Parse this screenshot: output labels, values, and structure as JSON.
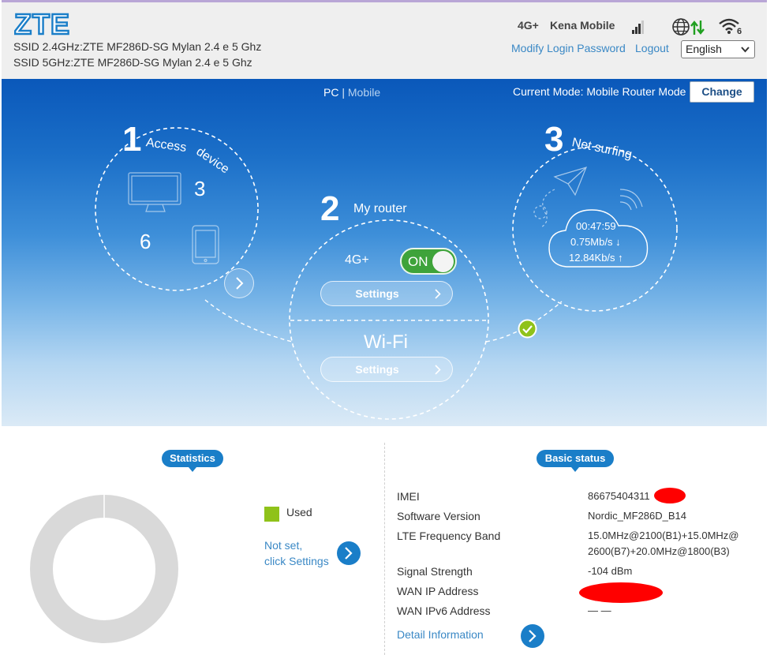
{
  "header": {
    "brand": "ZTE",
    "ssid_24": "SSID 2.4GHz:ZTE MF286D-SG Mylan 2.4 e 5 Ghz",
    "ssid_5": "SSID 5GHz:ZTE MF286D-SG Mylan 2.4 e 5 Ghz",
    "network_type": "4G+",
    "operator": "Kena Mobile",
    "wifi_clients": "6",
    "modify_password": "Modify Login Password",
    "logout": "Logout",
    "language": "English",
    "icons": [
      "signal-icon",
      "globe-icon",
      "updown-arrows-icon",
      "wifi-icon"
    ]
  },
  "hero": {
    "pc_label": "PC",
    "separator": "|",
    "mobile_label": "Mobile",
    "mode_text": "Current Mode: Mobile Router Mode",
    "change_label": "Change",
    "step1": {
      "num": "1",
      "title_a": "Access",
      "title_b": "device",
      "pc_count": "3",
      "mobile_count": "6"
    },
    "step2": {
      "num": "2",
      "title": "My router",
      "lte_label": "4G+",
      "toggle": "ON",
      "settings1": "Settings",
      "wifi_label": "Wi-Fi",
      "settings2": "Settings"
    },
    "step3": {
      "num": "3",
      "title": "Net surfing",
      "time": "00:47:59",
      "down": "0.75Mb/s ↓",
      "up": "12.84Kb/s ↑"
    },
    "colors": {
      "toggle_on": "#3ea33a",
      "check": "#8fc21a"
    }
  },
  "statistics": {
    "tag": "Statistics",
    "legend_used": "Used",
    "notset_line1": "Not set,",
    "notset_line2": "click Settings",
    "used_color": "#8fc21a"
  },
  "basic_status": {
    "tag": "Basic status",
    "rows": [
      {
        "label": "IMEI",
        "value": "86675404311"
      },
      {
        "label": "Software Version",
        "value": "Nordic_MF286D_B14"
      },
      {
        "label": "LTE Frequency Band",
        "value_line1": "15.0MHz@2100(B1)+15.0MHz@",
        "value_line2": "2600(B7)+20.0MHz@1800(B3)"
      },
      {
        "label": "Signal Strength",
        "value": "-104 dBm"
      },
      {
        "label": "WAN IP Address",
        "value": ""
      },
      {
        "label": "WAN IPv6 Address",
        "value": "— —"
      }
    ],
    "detail_link": "Detail Information",
    "accent": "#1a7ec8"
  }
}
